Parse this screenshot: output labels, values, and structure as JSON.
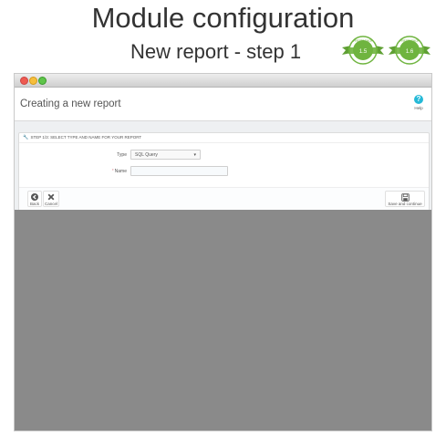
{
  "banner": {
    "headline": "Module configuration",
    "subheadline": "New report - step 1",
    "badges": [
      {
        "arc_text": "PRESTASHOP",
        "version": "1.5",
        "color": "#6fb43f"
      },
      {
        "arc_text": "PRESTASHOP",
        "version": "1.6",
        "color": "#6fb43f"
      }
    ]
  },
  "window": {
    "controls": [
      "close",
      "minimize",
      "zoom"
    ],
    "colors": {
      "close": "#ee5a50",
      "minimize": "#f6be3c",
      "zoom": "#5fc54a"
    }
  },
  "page": {
    "title": "Creating a new report",
    "help_label": "Help",
    "help_icon": "question-circle-icon"
  },
  "form": {
    "heading": "STEP 1/3: SELECT TYPE AND NAME FOR YOUR REPORT",
    "heading_icon": "wrench-icon",
    "type_label": "Type",
    "type_value": "SQL Query",
    "name_label": "Name",
    "name_required_mark": "*",
    "name_value": ""
  },
  "footer": {
    "back_label": "Back",
    "cancel_label": "Cancel",
    "save_label": "Save and continue"
  },
  "colors": {
    "accent": "#25b9d7",
    "required": "#e08f95",
    "backdrop": "#8a8a8a"
  }
}
